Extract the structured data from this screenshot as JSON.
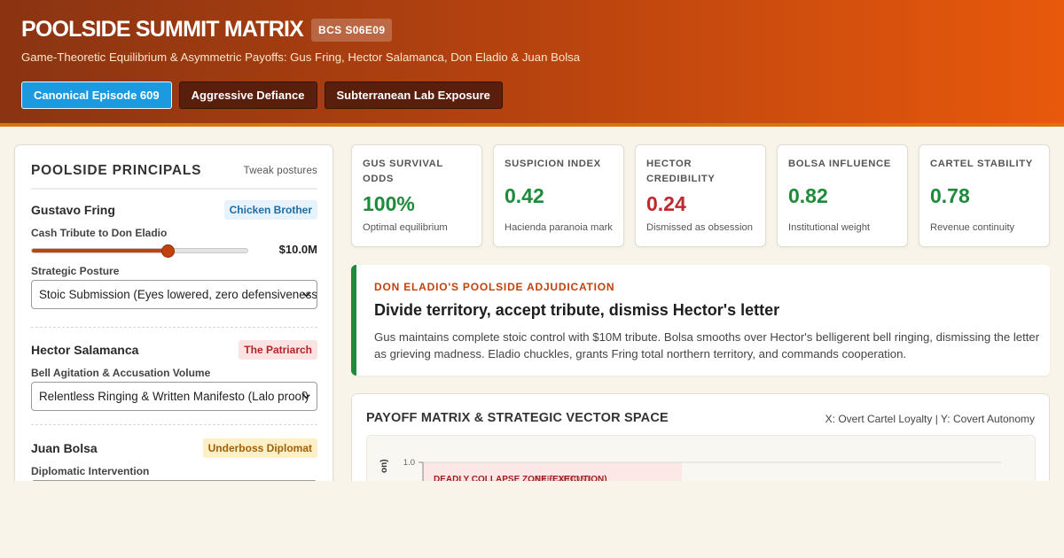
{
  "header": {
    "title": "POOLSIDE SUMMIT MATRIX",
    "episode": "BCS S06E09",
    "subtitle": "Game-Theoretic Equilibrium & Asymmetric Payoffs: Gus Fring, Hector Salamanca, Don Eladio & Juan Bolsa",
    "scenarios": [
      {
        "label": "Canonical Episode 609",
        "active": true
      },
      {
        "label": "Aggressive Defiance",
        "active": false
      },
      {
        "label": "Subterranean Lab Exposure",
        "active": false
      }
    ]
  },
  "panel": {
    "title": "POOLSIDE PRINCIPALS",
    "action": "Tweak postures",
    "actors": [
      {
        "name": "Gustavo Fring",
        "tag": "Chicken Brother",
        "slider_label": "Cash Tribute to Don Eladio",
        "slider_value": "$10.0M",
        "slider_fraction": 0.63,
        "select_label": "Strategic Posture",
        "select_value": "Stoic Submission (Eyes lowered, zero defensiveness)"
      },
      {
        "name": "Hector Salamanca",
        "tag": "The Patriarch",
        "select_label": "Bell Agitation & Accusation Volume",
        "select_value": "Relentless Ringing & Written Manifesto (Lalo proof)"
      },
      {
        "name": "Juan Bolsa",
        "tag": "Underboss Diplomat",
        "select_label": "Diplomatic Intervention"
      }
    ]
  },
  "kpis": [
    {
      "label": "GUS SURVIVAL ODDS",
      "value": "100%",
      "note": "Optimal equilibrium",
      "status": "good"
    },
    {
      "label": "SUSPICION INDEX",
      "value": "0.42",
      "note": "Hacienda paranoia mark",
      "status": "good"
    },
    {
      "label": "HECTOR CREDIBILITY",
      "value": "0.24",
      "note": "Dismissed as obsession",
      "status": "bad"
    },
    {
      "label": "BOLSA INFLUENCE",
      "value": "0.82",
      "note": "Institutional weight",
      "status": "good"
    },
    {
      "label": "CARTEL STABILITY",
      "value": "0.78",
      "note": "Revenue continuity",
      "status": "good"
    }
  ],
  "verdict": {
    "kicker": "DON ELADIO'S POOLSIDE ADJUDICATION",
    "headline": "Divide territory, accept tribute, dismiss Hector's letter",
    "body": "Gus maintains complete stoic control with $10M tribute. Bolsa smooths over Hector's belligerent bell ringing, dismissing the letter as grieving madness. Eladio chuckles, grants Fring total northern territory, and commands cooperation."
  },
  "matrix": {
    "title": "PAYOFF MATRIX & STRATEGIC VECTOR SPACE",
    "axes_note": "X: Overt Cartel Loyalty | Y: Covert Autonomy",
    "y_axis_label": "on)",
    "y_tick_top": "1.0",
    "zone_label": "DEADLY COLLAPSE ZONE (EXECUTION)",
    "zone_label_overlap": "...EXECUTION)"
  },
  "colors": {
    "accent": "#c2410c",
    "active_scenario": "#1c9ae0",
    "good": "#1d8a3c",
    "bad": "#c1272d"
  }
}
